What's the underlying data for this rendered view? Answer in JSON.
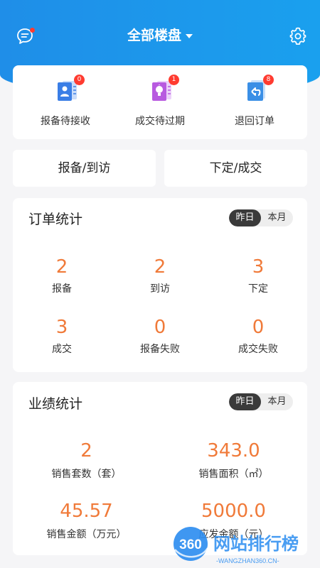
{
  "header": {
    "title": "全部楼盘"
  },
  "quick_actions": [
    {
      "label": "报备待接收",
      "badge": "0",
      "color": "#3a7ee6"
    },
    {
      "label": "成交待过期",
      "badge": "1",
      "color": "#b85ae0"
    },
    {
      "label": "退回订单",
      "badge": "8",
      "color": "#3a8fe6"
    }
  ],
  "tabs": {
    "left": "报备/到访",
    "right": "下定/成交"
  },
  "order_stats": {
    "title": "订单统计",
    "segments": [
      "昨日",
      "本月"
    ],
    "items": [
      {
        "value": "2",
        "label": "报备"
      },
      {
        "value": "2",
        "label": "到访"
      },
      {
        "value": "3",
        "label": "下定"
      },
      {
        "value": "3",
        "label": "成交"
      },
      {
        "value": "0",
        "label": "报备失败"
      },
      {
        "value": "0",
        "label": "成交失败"
      }
    ]
  },
  "performance": {
    "title": "业绩统计",
    "segments": [
      "昨日",
      "本月"
    ],
    "items": [
      {
        "value": "2",
        "label": "销售套数（套）"
      },
      {
        "value": "343.0",
        "label": "销售面积（㎡）"
      },
      {
        "value": "45.57",
        "label": "销售金额（万元）"
      },
      {
        "value": "5000.0",
        "label": "应发金额（元）"
      }
    ]
  },
  "watermark": {
    "logo": "360",
    "name": "网站排行榜",
    "domain": "-WANGZHAN360.CN-"
  }
}
